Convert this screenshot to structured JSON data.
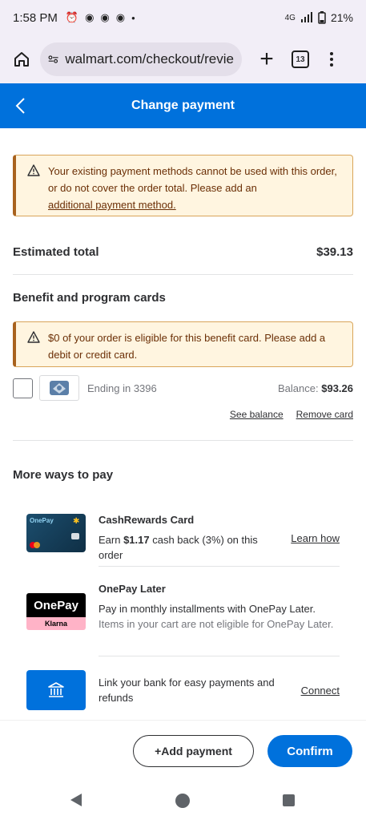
{
  "status_bar": {
    "time": "1:58 PM",
    "battery": "21%",
    "icons_left": [
      "alarm-icon",
      "chrome-icon",
      "chrome-icon",
      "chrome-icon",
      "dot-icon"
    ],
    "icons_right": [
      "lte-icon",
      "signal-icon",
      "battery-icon"
    ],
    "network": "4G LTE"
  },
  "browser": {
    "url": "walmart.com/checkout/revie",
    "tab_count": "13"
  },
  "header": {
    "title": "Change payment"
  },
  "alert_main": {
    "text": "Your existing payment methods cannot be used with this order, or do not cover the order total. Please add an",
    "link": "additional payment method."
  },
  "total": {
    "label": "Estimated total",
    "value": "$39.13"
  },
  "benefit": {
    "title": "Benefit and program cards",
    "alert": "$0 of your order is eligible for this benefit card. Please add a debit or credit card.",
    "card": {
      "ending": "Ending in 3396",
      "balance_label": "Balance:",
      "balance_value": "$93.26",
      "see_balance": "See balance",
      "remove_card": "Remove card"
    }
  },
  "more_ways": {
    "title": "More ways to pay",
    "items": [
      {
        "title": "CashRewards Card",
        "desc_pre": "Earn ",
        "desc_bold": "$1.17",
        "desc_post": " cash back (3%) on this order",
        "action": "Learn how",
        "thumb_text": "OnePay"
      },
      {
        "title": "OnePay Later",
        "desc": "Pay in monthly installments with OnePay Later.",
        "desc_grey": "Items in your cart are not eligible for OnePay Later.",
        "thumb_text": "OnePay",
        "thumb_sub": "Klarna"
      },
      {
        "desc": "Link your bank for easy payments and refunds",
        "action": "Connect"
      }
    ]
  },
  "buttons": {
    "add_payment": "+Add payment",
    "confirm": "Confirm"
  },
  "colors": {
    "brand_blue": "#0071dc",
    "alert_bg": "#fff5e0",
    "alert_text": "#6b2f06"
  }
}
